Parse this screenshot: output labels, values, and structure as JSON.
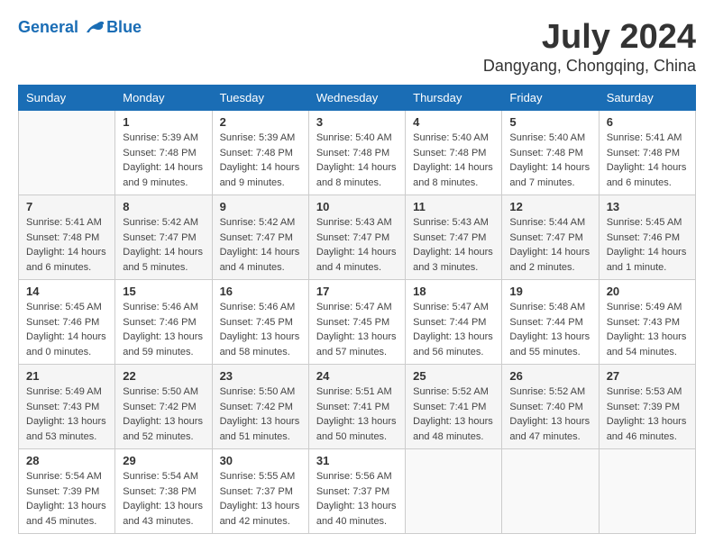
{
  "header": {
    "logo_line1": "General",
    "logo_line2": "Blue",
    "main_title": "July 2024",
    "subtitle": "Dangyang, Chongqing, China"
  },
  "calendar": {
    "columns": [
      "Sunday",
      "Monday",
      "Tuesday",
      "Wednesday",
      "Thursday",
      "Friday",
      "Saturday"
    ],
    "rows": [
      [
        {
          "date": "",
          "info": ""
        },
        {
          "date": "1",
          "info": "Sunrise: 5:39 AM\nSunset: 7:48 PM\nDaylight: 14 hours\nand 9 minutes."
        },
        {
          "date": "2",
          "info": "Sunrise: 5:39 AM\nSunset: 7:48 PM\nDaylight: 14 hours\nand 9 minutes."
        },
        {
          "date": "3",
          "info": "Sunrise: 5:40 AM\nSunset: 7:48 PM\nDaylight: 14 hours\nand 8 minutes."
        },
        {
          "date": "4",
          "info": "Sunrise: 5:40 AM\nSunset: 7:48 PM\nDaylight: 14 hours\nand 8 minutes."
        },
        {
          "date": "5",
          "info": "Sunrise: 5:40 AM\nSunset: 7:48 PM\nDaylight: 14 hours\nand 7 minutes."
        },
        {
          "date": "6",
          "info": "Sunrise: 5:41 AM\nSunset: 7:48 PM\nDaylight: 14 hours\nand 6 minutes."
        }
      ],
      [
        {
          "date": "7",
          "info": "Sunrise: 5:41 AM\nSunset: 7:48 PM\nDaylight: 14 hours\nand 6 minutes."
        },
        {
          "date": "8",
          "info": "Sunrise: 5:42 AM\nSunset: 7:47 PM\nDaylight: 14 hours\nand 5 minutes."
        },
        {
          "date": "9",
          "info": "Sunrise: 5:42 AM\nSunset: 7:47 PM\nDaylight: 14 hours\nand 4 minutes."
        },
        {
          "date": "10",
          "info": "Sunrise: 5:43 AM\nSunset: 7:47 PM\nDaylight: 14 hours\nand 4 minutes."
        },
        {
          "date": "11",
          "info": "Sunrise: 5:43 AM\nSunset: 7:47 PM\nDaylight: 14 hours\nand 3 minutes."
        },
        {
          "date": "12",
          "info": "Sunrise: 5:44 AM\nSunset: 7:47 PM\nDaylight: 14 hours\nand 2 minutes."
        },
        {
          "date": "13",
          "info": "Sunrise: 5:45 AM\nSunset: 7:46 PM\nDaylight: 14 hours\nand 1 minute."
        }
      ],
      [
        {
          "date": "14",
          "info": "Sunrise: 5:45 AM\nSunset: 7:46 PM\nDaylight: 14 hours\nand 0 minutes."
        },
        {
          "date": "15",
          "info": "Sunrise: 5:46 AM\nSunset: 7:46 PM\nDaylight: 13 hours\nand 59 minutes."
        },
        {
          "date": "16",
          "info": "Sunrise: 5:46 AM\nSunset: 7:45 PM\nDaylight: 13 hours\nand 58 minutes."
        },
        {
          "date": "17",
          "info": "Sunrise: 5:47 AM\nSunset: 7:45 PM\nDaylight: 13 hours\nand 57 minutes."
        },
        {
          "date": "18",
          "info": "Sunrise: 5:47 AM\nSunset: 7:44 PM\nDaylight: 13 hours\nand 56 minutes."
        },
        {
          "date": "19",
          "info": "Sunrise: 5:48 AM\nSunset: 7:44 PM\nDaylight: 13 hours\nand 55 minutes."
        },
        {
          "date": "20",
          "info": "Sunrise: 5:49 AM\nSunset: 7:43 PM\nDaylight: 13 hours\nand 54 minutes."
        }
      ],
      [
        {
          "date": "21",
          "info": "Sunrise: 5:49 AM\nSunset: 7:43 PM\nDaylight: 13 hours\nand 53 minutes."
        },
        {
          "date": "22",
          "info": "Sunrise: 5:50 AM\nSunset: 7:42 PM\nDaylight: 13 hours\nand 52 minutes."
        },
        {
          "date": "23",
          "info": "Sunrise: 5:50 AM\nSunset: 7:42 PM\nDaylight: 13 hours\nand 51 minutes."
        },
        {
          "date": "24",
          "info": "Sunrise: 5:51 AM\nSunset: 7:41 PM\nDaylight: 13 hours\nand 50 minutes."
        },
        {
          "date": "25",
          "info": "Sunrise: 5:52 AM\nSunset: 7:41 PM\nDaylight: 13 hours\nand 48 minutes."
        },
        {
          "date": "26",
          "info": "Sunrise: 5:52 AM\nSunset: 7:40 PM\nDaylight: 13 hours\nand 47 minutes."
        },
        {
          "date": "27",
          "info": "Sunrise: 5:53 AM\nSunset: 7:39 PM\nDaylight: 13 hours\nand 46 minutes."
        }
      ],
      [
        {
          "date": "28",
          "info": "Sunrise: 5:54 AM\nSunset: 7:39 PM\nDaylight: 13 hours\nand 45 minutes."
        },
        {
          "date": "29",
          "info": "Sunrise: 5:54 AM\nSunset: 7:38 PM\nDaylight: 13 hours\nand 43 minutes."
        },
        {
          "date": "30",
          "info": "Sunrise: 5:55 AM\nSunset: 7:37 PM\nDaylight: 13 hours\nand 42 minutes."
        },
        {
          "date": "31",
          "info": "Sunrise: 5:56 AM\nSunset: 7:37 PM\nDaylight: 13 hours\nand 40 minutes."
        },
        {
          "date": "",
          "info": ""
        },
        {
          "date": "",
          "info": ""
        },
        {
          "date": "",
          "info": ""
        }
      ]
    ]
  }
}
